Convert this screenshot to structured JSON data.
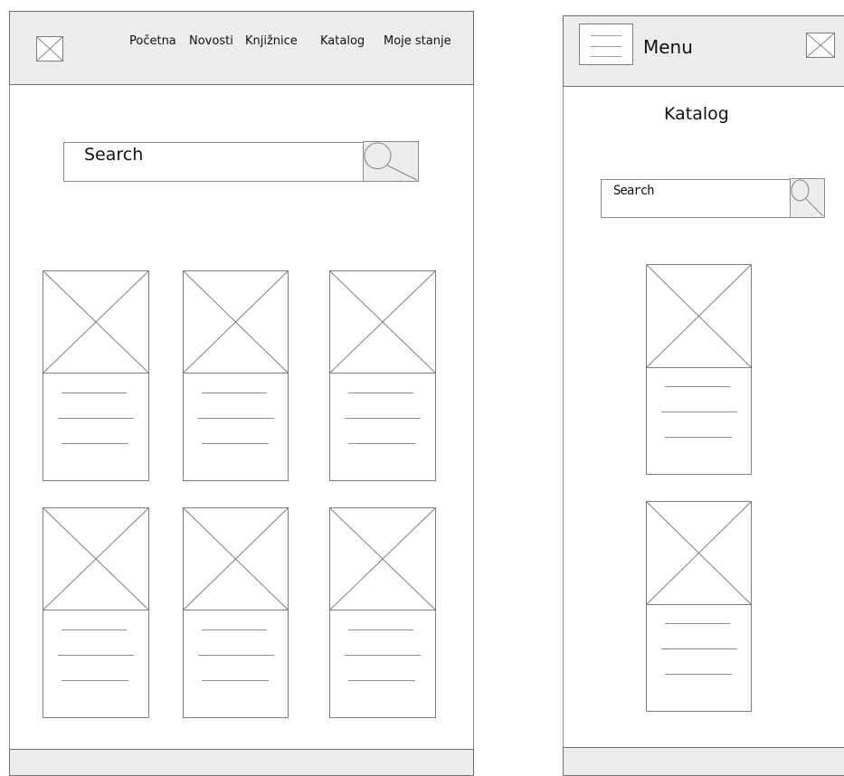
{
  "desktop": {
    "nav": [
      "Početna",
      "Novosti",
      "Knjižnice",
      "Katalog",
      "Moje stanje"
    ],
    "search": {
      "label": "Search"
    }
  },
  "mobile": {
    "menu_label": "Menu",
    "page_title": "Katalog",
    "search": {
      "label": "Search"
    }
  }
}
